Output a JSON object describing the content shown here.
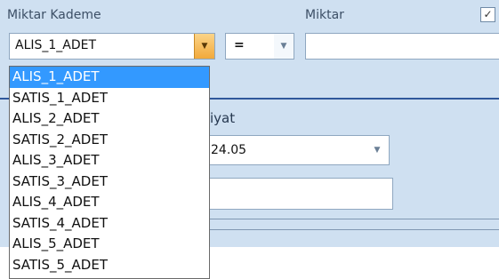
{
  "labels": {
    "miktar_kademe": "Miktar Kademe",
    "miktar": "Miktar",
    "fiyat_partial": "iyat"
  },
  "checkbox": {
    "checked": true,
    "glyph": "✓"
  },
  "kademe_combo": {
    "value": "ALIS_1_ADET",
    "button_icon": "chevron-down-icon"
  },
  "operator_combo": {
    "value": "=",
    "button_icon": "chevron-down-icon"
  },
  "miktar_input": {
    "value": ""
  },
  "fiyat_combo": {
    "value": "24.05",
    "button_icon": "chevron-down-icon"
  },
  "fiyat_input": {
    "value": ""
  },
  "dropdown": {
    "selected_index": 0,
    "items": [
      "ALIS_1_ADET",
      "SATIS_1_ADET",
      "ALIS_2_ADET",
      "SATIS_2_ADET",
      "ALIS_3_ADET",
      "SATIS_3_ADET",
      "ALIS_4_ADET",
      "SATIS_4_ADET",
      "ALIS_5_ADET",
      "SATIS_5_ADET"
    ]
  },
  "colors": {
    "panel": "#cfe0f1",
    "accent_line": "#30589b",
    "selection": "#3399ff",
    "button_orange": "#f2a93b"
  }
}
